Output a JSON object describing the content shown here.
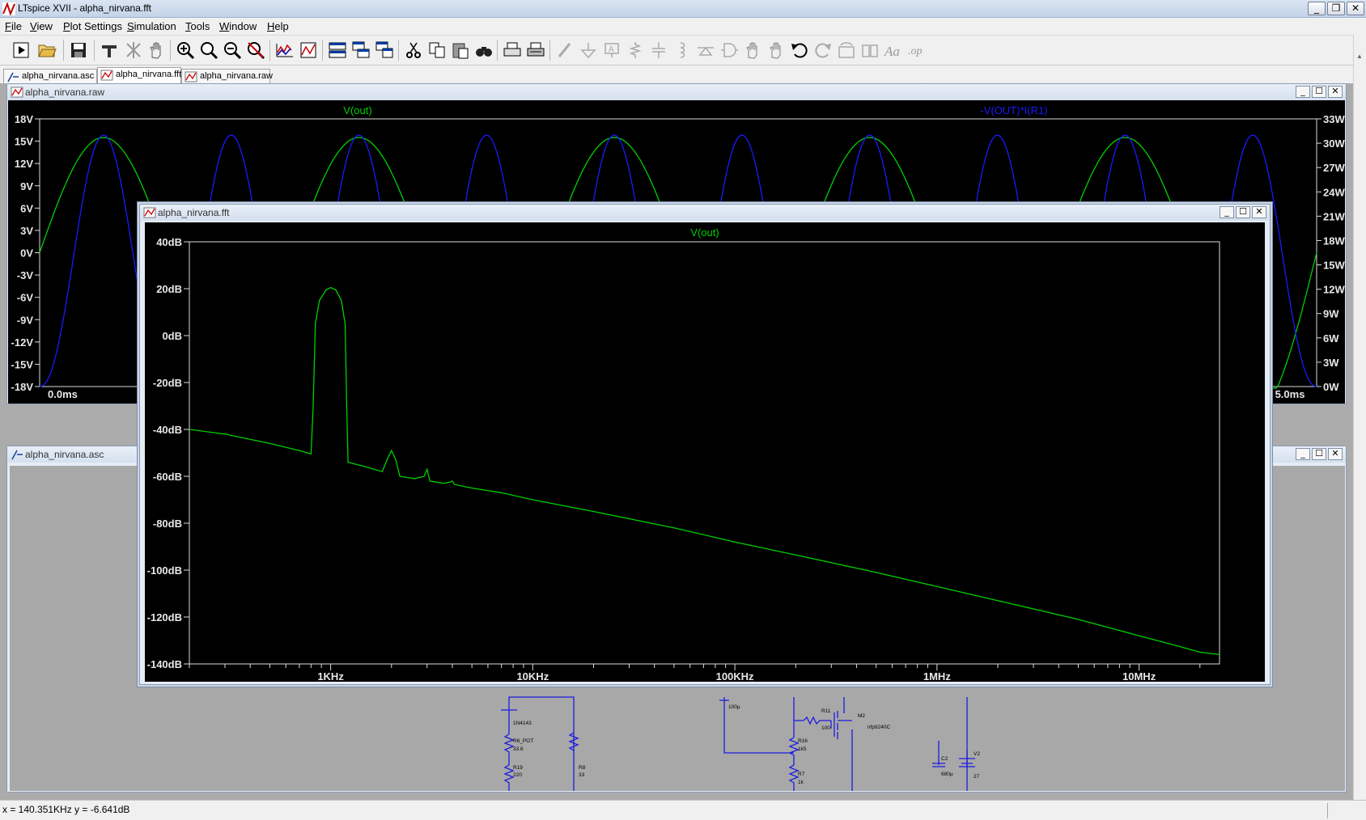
{
  "app": {
    "title": "LTspice XVII - alpha_nirvana.fft",
    "window_controls": [
      "_",
      "❐",
      "✕"
    ]
  },
  "menu": [
    "File",
    "View",
    "Plot Settings",
    "Simulation",
    "Tools",
    "Window",
    "Help"
  ],
  "toolbar": {
    "icons": [
      "run-icon",
      "open-icon",
      "save-icon",
      "control-panel-icon",
      "halt-icon",
      "pan-icon",
      "zoom-in-icon",
      "zoom-area-icon",
      "zoom-out-icon",
      "zoom-fit-icon",
      "autorange-icon",
      "add-plot-pane-icon",
      "tile-horizontal-icon",
      "cascade-icon",
      "tile-vertical-icon",
      "cut-icon",
      "copy-icon",
      "paste-icon",
      "find-icon",
      "print-icon",
      "print-setup-icon",
      "wire-icon",
      "ground-icon",
      "label-net-icon",
      "resistor-icon",
      "capacitor-icon",
      "inductor-icon",
      "diode-icon",
      "component-icon",
      "move-icon",
      "drag-icon",
      "undo-icon",
      "redo-icon",
      "rotate-icon",
      "mirror-icon",
      "text-icon",
      "spice-directive-icon"
    ]
  },
  "tabs": [
    {
      "label": "alpha_nirvana.asc",
      "icon": "schematic-icon"
    },
    {
      "label": "alpha_nirvana.fft",
      "icon": "waveform-icon"
    },
    {
      "label": "alpha_nirvana.raw",
      "icon": "waveform-icon"
    }
  ],
  "windows": {
    "raw": {
      "title": "alpha_nirvana.raw",
      "trace_left": "V(out)",
      "trace_right": "-V(OUT)*I(R1)",
      "trace_left_color": "#00d000",
      "trace_right_color": "#1a1aff",
      "y_left_ticks": [
        "18V",
        "15V",
        "12V",
        "9V",
        "6V",
        "3V",
        "0V",
        "-3V",
        "-6V",
        "-9V",
        "-12V",
        "-15V",
        "-18V"
      ],
      "y_right_ticks": [
        "33W",
        "30W",
        "27W",
        "24W",
        "21W",
        "18W",
        "15W",
        "12W",
        "9W",
        "6W",
        "3W",
        "0W"
      ],
      "x_start": "0.0ms",
      "x_end": "5.0ms"
    },
    "asc": {
      "title": "alpha_nirvana.asc",
      "components": {
        "d1": "1N4143",
        "r6_name": "R6_POT",
        "r6_val": "33.6",
        "r19_name": "R19",
        "r19_val": "220",
        "r8_name": "R8",
        "r8_val": "33",
        "c_top_val": "100µ",
        "r11_name": "R11",
        "r11_val": "100",
        "r16_name": "R16",
        "r16_val": "1k5",
        "r7_name": "R7",
        "r7_val": "1k",
        "m2_name": "M2",
        "m2_val": "irfp9240C",
        "c2_name": "C2",
        "c2_val": "680µ",
        "v2_name": "V2",
        "v2_val": "27"
      }
    },
    "fft": {
      "title": "alpha_nirvana.fft",
      "trace": "V(out)",
      "trace_color": "#00d000"
    }
  },
  "chart_data": [
    {
      "type": "line",
      "title": "V(out)",
      "x_scale": "log",
      "xlim": [
        200,
        25000000
      ],
      "ylim": [
        -140,
        40
      ],
      "y_unit": "dB",
      "xticks": [
        {
          "value": 1000,
          "label": "1KHz"
        },
        {
          "value": 10000,
          "label": "10KHz"
        },
        {
          "value": 100000,
          "label": "100KHz"
        },
        {
          "value": 1000000,
          "label": "1MHz"
        },
        {
          "value": 10000000,
          "label": "10MHz"
        }
      ],
      "yticks": [
        {
          "value": 40,
          "label": "40dB"
        },
        {
          "value": 20,
          "label": "20dB"
        },
        {
          "value": 0,
          "label": "0dB"
        },
        {
          "value": -20,
          "label": "-20dB"
        },
        {
          "value": -40,
          "label": "-40dB"
        },
        {
          "value": -60,
          "label": "-60dB"
        },
        {
          "value": -80,
          "label": "-80dB"
        },
        {
          "value": -100,
          "label": "-100dB"
        },
        {
          "value": -120,
          "label": "-120dB"
        },
        {
          "value": -140,
          "label": "-140dB"
        }
      ],
      "grid": false,
      "series": [
        {
          "name": "V(out)",
          "color": "#00d000",
          "points": [
            [
              200,
              -40
            ],
            [
              300,
              -42
            ],
            [
              500,
              -46
            ],
            [
              700,
              -49
            ],
            [
              800,
              -50.5
            ],
            [
              820,
              -30
            ],
            [
              840,
              5
            ],
            [
              880,
              15
            ],
            [
              950,
              19.5
            ],
            [
              1000,
              20.5
            ],
            [
              1060,
              19.5
            ],
            [
              1130,
              15
            ],
            [
              1180,
              5
            ],
            [
              1200,
              -30
            ],
            [
              1220,
              -54
            ],
            [
              1500,
              -56
            ],
            [
              1800,
              -58
            ],
            [
              1900,
              -53
            ],
            [
              2000,
              -49
            ],
            [
              2100,
              -53
            ],
            [
              2200,
              -60
            ],
            [
              2600,
              -61
            ],
            [
              2900,
              -60
            ],
            [
              3000,
              -57
            ],
            [
              3100,
              -62
            ],
            [
              3600,
              -63
            ],
            [
              3900,
              -62.5
            ],
            [
              4000,
              -62
            ],
            [
              4100,
              -63.5
            ],
            [
              5000,
              -65
            ],
            [
              7000,
              -67
            ],
            [
              10000,
              -70
            ],
            [
              20000,
              -75
            ],
            [
              50000,
              -82
            ],
            [
              100000,
              -88
            ],
            [
              200000,
              -93.5
            ],
            [
              500000,
              -101
            ],
            [
              1000000,
              -107
            ],
            [
              2000000,
              -113
            ],
            [
              5000000,
              -121
            ],
            [
              10000000,
              -128
            ],
            [
              15000000,
              -132
            ],
            [
              20000000,
              -135
            ],
            [
              25000000,
              -136
            ]
          ]
        }
      ]
    },
    {
      "type": "line",
      "title": "",
      "xlim": [
        0,
        5
      ],
      "x_unit": "ms",
      "ylim_left": [
        -18,
        18
      ],
      "ylim_right": [
        0,
        33
      ],
      "grid": false,
      "series": [
        {
          "name": "V(out)",
          "axis": "left",
          "color": "#00d000",
          "model": "half-rectified sine, period 1ms, peak 15.5V, negative half clipped to -8V (partially hidden)",
          "points": [
            [
              0,
              0
            ],
            [
              0.125,
              11
            ],
            [
              0.25,
              15.5
            ],
            [
              0.375,
              11
            ],
            [
              0.5,
              0
            ],
            [
              1.0,
              0
            ],
            [
              1.25,
              15.5
            ],
            [
              1.5,
              0
            ],
            [
              2.0,
              0
            ],
            [
              2.25,
              15.5
            ],
            [
              2.5,
              0
            ],
            [
              3.0,
              0
            ],
            [
              3.25,
              15.5
            ],
            [
              3.5,
              0
            ],
            [
              4.0,
              0
            ],
            [
              4.25,
              15.5
            ],
            [
              4.5,
              0
            ],
            [
              5.0,
              0
            ]
          ]
        },
        {
          "name": "-V(OUT)*I(R1)",
          "axis": "right",
          "color": "#1a1aff",
          "model": "power pulses at twice the line rate, peak 31W",
          "points": [
            [
              0,
              0
            ],
            [
              0.25,
              31
            ],
            [
              0.5,
              0
            ],
            [
              0.75,
              31
            ],
            [
              1.0,
              0
            ],
            [
              1.25,
              31
            ],
            [
              1.5,
              0
            ],
            [
              1.75,
              31
            ],
            [
              2.0,
              0
            ],
            [
              2.25,
              31
            ],
            [
              2.5,
              0
            ],
            [
              2.75,
              31
            ],
            [
              3.0,
              0
            ],
            [
              3.25,
              31
            ],
            [
              3.5,
              0
            ],
            [
              3.75,
              31
            ],
            [
              4.0,
              0
            ],
            [
              4.25,
              31
            ],
            [
              4.5,
              0
            ],
            [
              4.75,
              31
            ],
            [
              5.0,
              0
            ]
          ]
        }
      ]
    }
  ],
  "status": {
    "cursor": "x = 140.351KHz    y = -6.641dB"
  }
}
